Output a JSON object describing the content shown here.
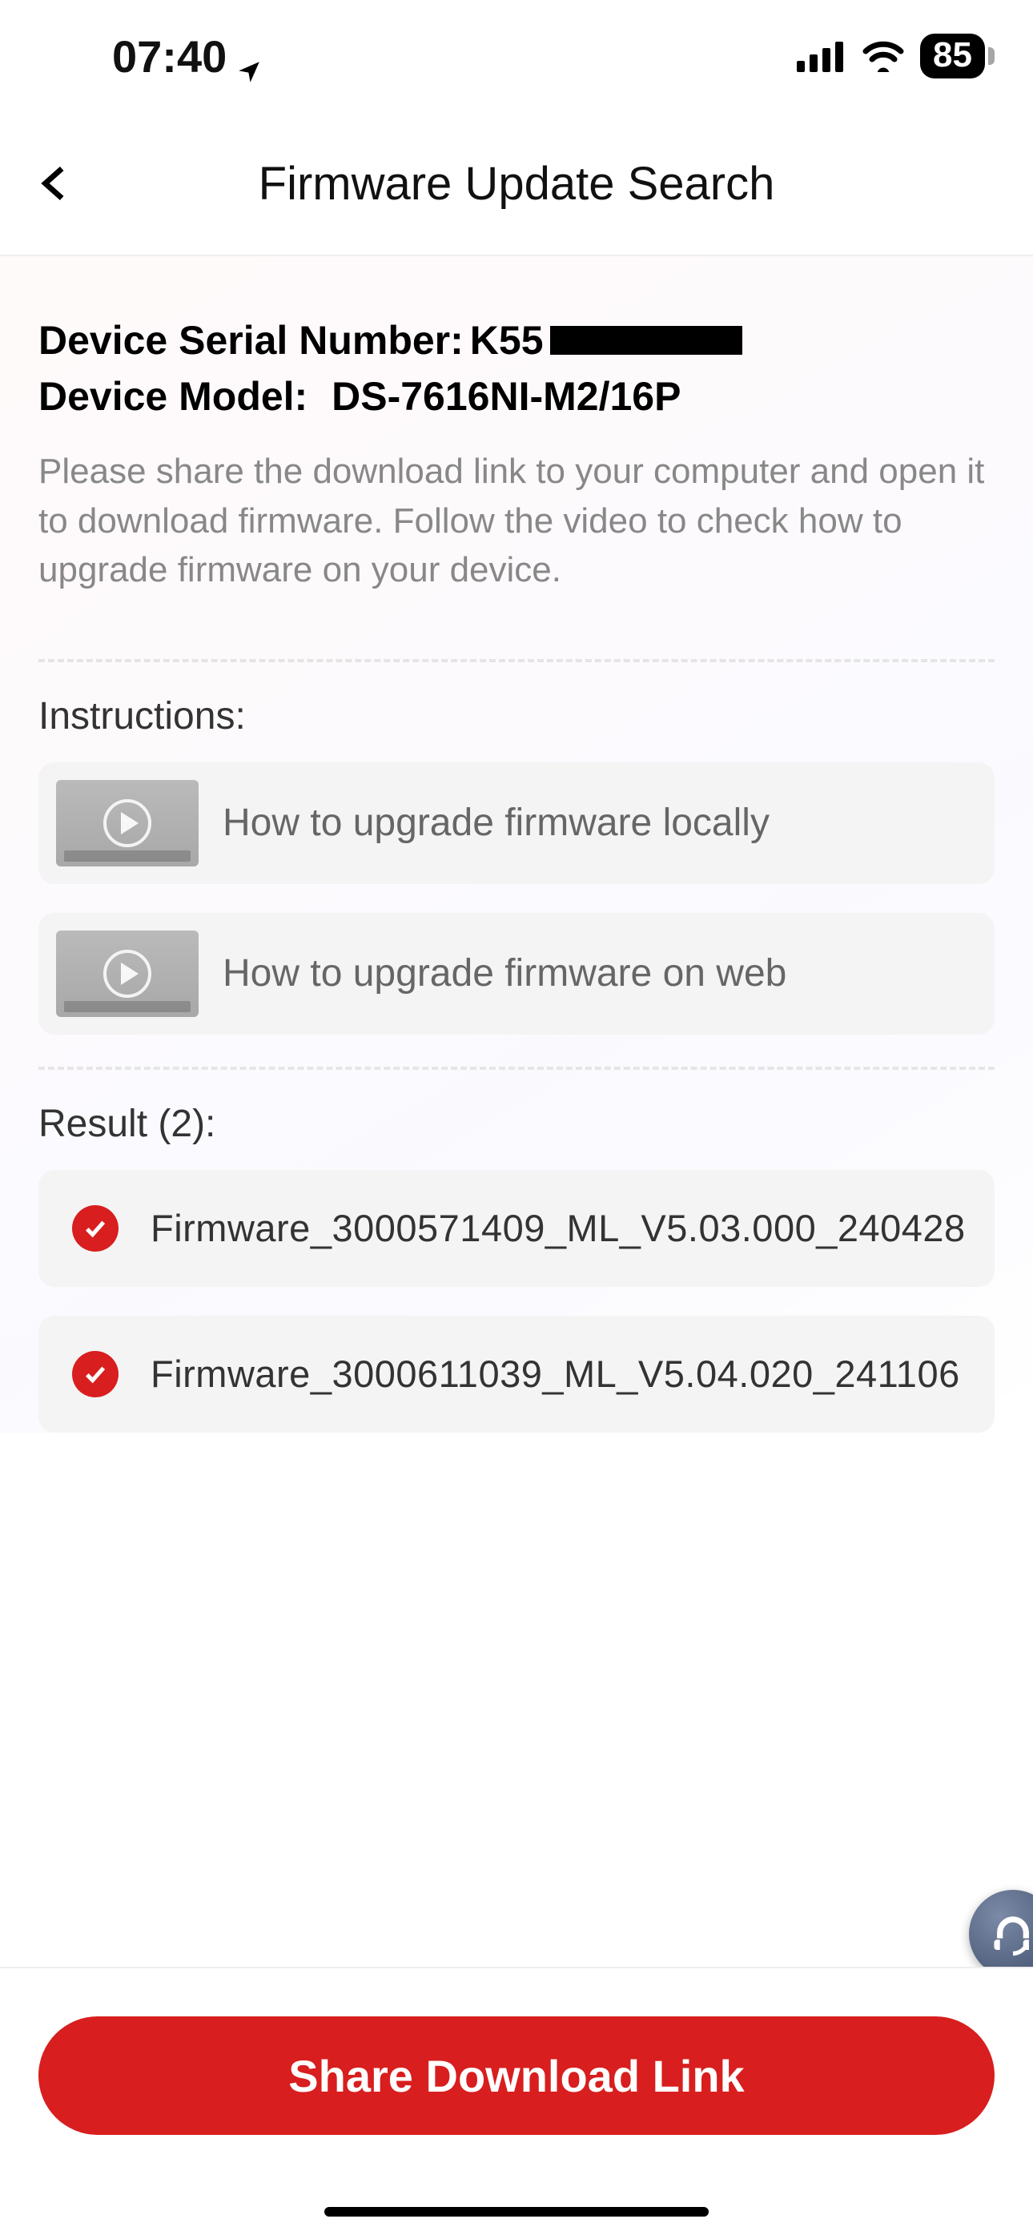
{
  "status": {
    "time": "07:40",
    "battery": "85"
  },
  "header": {
    "title": "Firmware Update Search"
  },
  "device": {
    "serial_label": "Device Serial Number:",
    "serial_value_visible": "K55",
    "model_label": "Device Model:",
    "model_value": "DS-7616NI-M2/16P"
  },
  "help_text": "Please share the download link to your computer and open it to download firmware. Follow the video to check how to upgrade firmware on your device.",
  "instructions": {
    "label": "Instructions:",
    "items": [
      {
        "title": "How to upgrade firmware locally"
      },
      {
        "title": "How to upgrade firmware on web"
      }
    ]
  },
  "results": {
    "label": "Result (2):",
    "items": [
      {
        "name": "Firmware_3000571409_ML_V5.03.000_240428"
      },
      {
        "name": "Firmware_3000611039_ML_V5.04.020_241106"
      }
    ]
  },
  "footer": {
    "share_button": "Share Download Link"
  }
}
